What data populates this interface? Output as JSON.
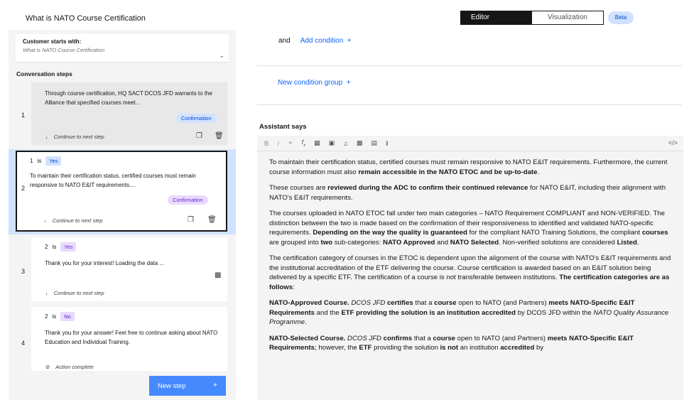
{
  "header": {
    "action_title": "What is NATO Course Certification",
    "tabs": [
      {
        "label": "Editor",
        "active": true
      },
      {
        "label": "Visualization",
        "active": false
      }
    ],
    "badge": "Beta"
  },
  "sidebar": {
    "customer_starts_label": "Customer starts with:",
    "customer_starts_value": "What is NATO Course Certification",
    "steps_heading": "Conversation steps",
    "steps": [
      {
        "number": "1",
        "message": "Through course certification, HQ SACT DCOS JFD warrants to the Alliance that specified courses meet...",
        "response_type": "Confirmation",
        "next": "Continue to next step"
      },
      {
        "number": "2",
        "condition_ref": "1",
        "condition_op": "is",
        "condition_value": "Yes",
        "message": "To maintain their certification status, certified courses must remain responsive to NATO E&IT requirements....",
        "response_type": "Confirmation",
        "next": "Continue to next step"
      },
      {
        "number": "3",
        "condition_ref": "2",
        "condition_op": "is",
        "condition_value": "Yes",
        "message": "Thank you for your interest! Loading the data ...",
        "next": "Continue to next step"
      },
      {
        "number": "4",
        "condition_ref": "2",
        "condition_op": "is",
        "condition_value": "No",
        "message": "Thank you for your answer! Feel free to continue asking about NATO Education and Individual Training.",
        "next": "Action complete"
      }
    ],
    "new_step_label": "New step"
  },
  "conditions": {
    "and_label": "and",
    "add_condition": "Add condition",
    "new_condition_group": "New condition group"
  },
  "assistant": {
    "label": "Assistant says",
    "toolbar": [
      "B",
      "I",
      "link",
      "fx",
      "option",
      "image",
      "audio",
      "video",
      "iframe",
      "pause"
    ]
  },
  "colors": {
    "accent": "#0f62fe",
    "selected_step_bg": "#d0e2ff",
    "confirmation_tag": "#d0e2ff",
    "purple_tag": "#e8daff"
  }
}
